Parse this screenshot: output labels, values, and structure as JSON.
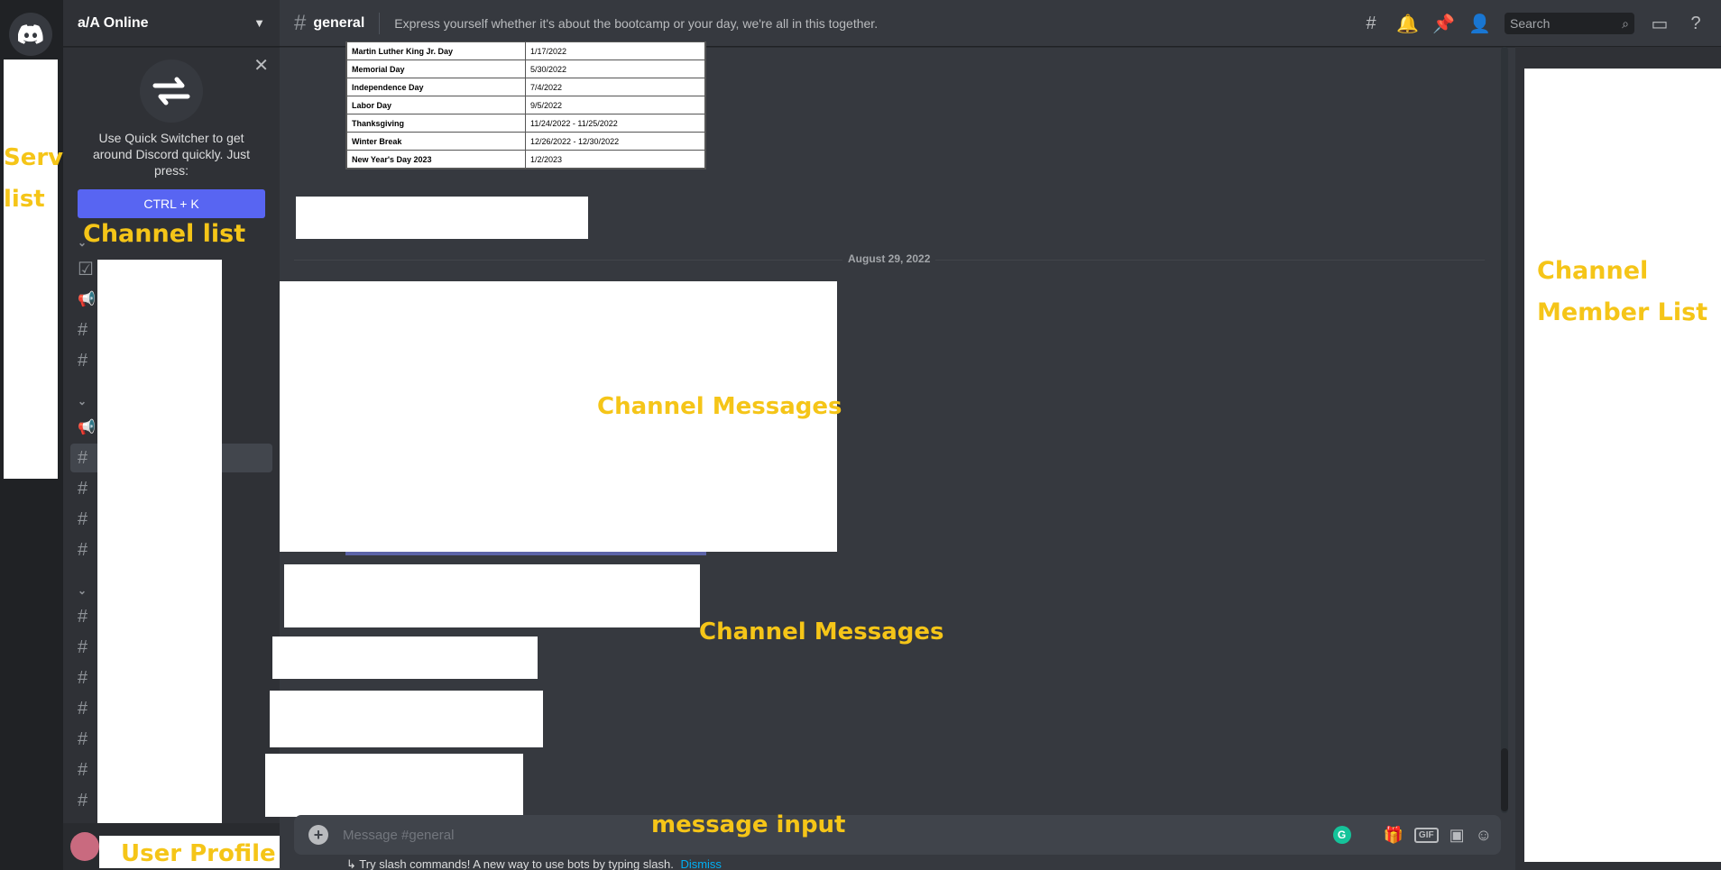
{
  "server": {
    "name": "a/A Online"
  },
  "quick_switcher": {
    "text": "Use Quick Switcher to get around Discord quickly. Just press:",
    "shortcut": "CTRL + K"
  },
  "channel": {
    "name": "general",
    "topic": "Express yourself whether it's about the bootcamp or your day, we're all in this together."
  },
  "search": {
    "placeholder": "Search"
  },
  "holiday_table": [
    {
      "name": "Martin Luther King Jr. Day",
      "date": "1/17/2022"
    },
    {
      "name": "Memorial Day",
      "date": "5/30/2022"
    },
    {
      "name": "Independence Day",
      "date": "7/4/2022"
    },
    {
      "name": "Labor Day",
      "date": "9/5/2022"
    },
    {
      "name": "Thanksgiving",
      "date": "11/24/2022 - 11/25/2022"
    },
    {
      "name": "Winter Break",
      "date": "12/26/2022 - 12/30/2022"
    },
    {
      "name": "New Year's Day 2023",
      "date": "1/2/2023"
    }
  ],
  "date_divider": "August 29, 2022",
  "composer": {
    "placeholder": "Message #general"
  },
  "slash_tip": {
    "text": "Try slash commands! A new way to use bots by typing slash.",
    "dismiss": "Dismiss"
  },
  "annotations": {
    "server_list": "Server list",
    "channel_list": "Channel list",
    "channel_messages": "Channel Messages",
    "channel_member_list": "Channel Member List",
    "message_input": "message input",
    "user_profile": "User Profile"
  },
  "icons": {
    "home": "discord-logo-icon",
    "threads": "threads-icon",
    "bell": "bell-icon",
    "pin": "pin-icon",
    "members": "members-icon",
    "inbox": "inbox-icon",
    "help": "help-icon",
    "gift": "gift-icon",
    "gif": "gif-icon",
    "sticker": "sticker-icon",
    "emoji": "emoji-icon"
  },
  "colors": {
    "blurple": "#5865f2",
    "annotation": "#f5c518",
    "link": "#00aff4"
  }
}
